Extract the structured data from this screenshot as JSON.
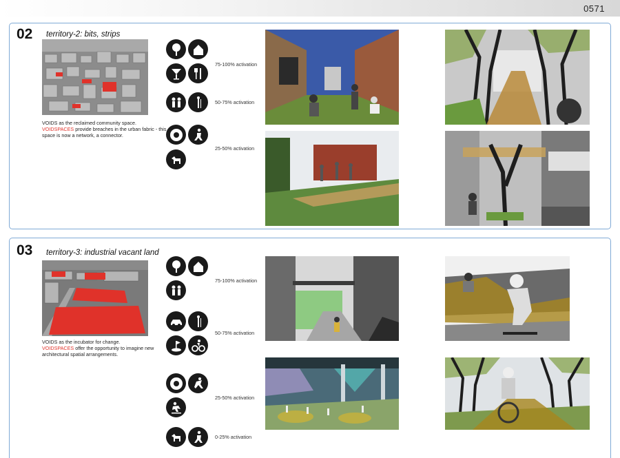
{
  "page_number": "0571",
  "sections": [
    {
      "number": "02",
      "title": "territory-2: bits, strips",
      "caption_line1": "VOIDS as the reclaimed community space.",
      "caption_highlight": "VOIDSPACES",
      "caption_line2": " provide breaches in the urban fabric - this space is now a network, a connector.",
      "activations": [
        "75-100% activation",
        "50-75% activation",
        "25-50% activation"
      ],
      "icons": [
        "tree-icon",
        "house-icon",
        "cocktail-icon",
        "dining-icon",
        "people-icon",
        "figure-icon",
        "tire-icon",
        "hiker-icon",
        "dog-icon"
      ]
    },
    {
      "number": "03",
      "title": "territory-3: industrial vacant land",
      "caption_line1": "VOIDS as the incubator for change.",
      "caption_highlight": "VOIDSPACES",
      "caption_line2": " offer the opportunity to imagine new architectural spatial arrangements.",
      "activations": [
        "75-100% activation",
        "50-75% activation",
        "25-50% activation",
        "0-25% activation"
      ],
      "icons": [
        "tree-icon",
        "house-icon",
        "people-icon",
        "car-icon",
        "figure-icon",
        "golf-icon",
        "cyclist-icon",
        "tire-icon",
        "climber-icon",
        "skater-icon",
        "dog-icon",
        "hiker-icon"
      ]
    }
  ],
  "colors": {
    "accent_red": "#e0322a",
    "panel_border": "#7fa9d6",
    "icon_fill": "#1a1a1a"
  }
}
